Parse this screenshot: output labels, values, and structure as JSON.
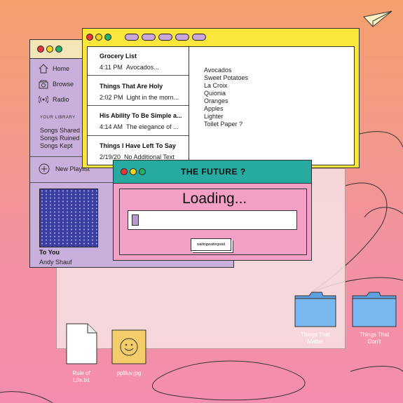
{
  "music_player": {
    "nav": [
      {
        "label": "Home",
        "icon": "home-icon"
      },
      {
        "label": "Browse",
        "icon": "browse-icon"
      },
      {
        "label": "Radio",
        "icon": "radio-icon"
      }
    ],
    "library_title": "YOUR LIBRARY",
    "library": [
      "Songs Shared",
      "Songs Ruined",
      "Songs Kept"
    ],
    "new_playlist": "New Playlist",
    "now_playing": {
      "song": "To You",
      "artist": "Andy Shauf"
    }
  },
  "notes_window": {
    "notes": [
      {
        "title": "Grocery List",
        "time": "4:11 PM",
        "preview": "Avocados..."
      },
      {
        "title": "Things That Are Holy",
        "time": "2:02 PM",
        "preview": "Light in the morn..."
      },
      {
        "title": "His Ability To Be Simple a...",
        "time": "4:14 AM",
        "preview": "The elegance of ..."
      },
      {
        "title": "Things I Have Left To Say",
        "time": "2/19/20",
        "preview": "No Additional Text"
      }
    ],
    "items": [
      "Avocados",
      "Sweet Potatoes",
      "La Croix",
      "Quionia",
      "Oranges",
      "Apples",
      "Lighter",
      "Toilet Paper ?"
    ]
  },
  "future_window": {
    "title": "THE FUTURE ?",
    "loading_text": "Loading...",
    "progress_fraction": 0.04,
    "wait_label": "waitingwaitingwait"
  },
  "desktop": {
    "folders": [
      "Things That Matter",
      "Things That Don't"
    ],
    "files": [
      {
        "name": "Rule of Life.txt",
        "icon": "document-icon"
      },
      {
        "name": "ppliluv.jpg",
        "icon": "smiley-image-icon"
      }
    ]
  },
  "colors": {
    "notes_frame": "#fbe73b",
    "future_bar": "#27aaa0",
    "future_body": "#f2a0c6",
    "player": "#c9b0dc"
  }
}
